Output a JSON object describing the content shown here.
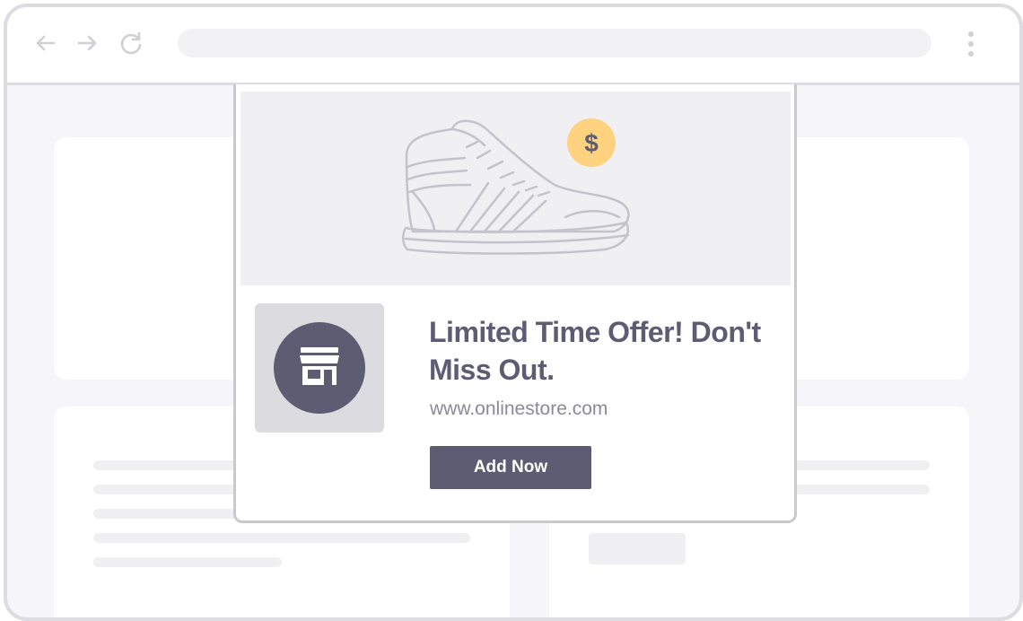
{
  "browser": {
    "back_icon": "arrow-left-icon",
    "forward_icon": "arrow-right-icon",
    "reload_icon": "reload-icon",
    "menu_icon": "vertical-dots-icon"
  },
  "ad": {
    "headline": "Limited Time Offer! Don't Miss Out.",
    "url": "www.onlinestore.com",
    "cta_label": "Add Now",
    "price_badge": "$",
    "hero_icon": "sneaker-icon",
    "store_icon": "storefront-icon"
  },
  "colors": {
    "accent": "#5d5c72",
    "badge": "#ffd27f",
    "background": "#f6f6f8",
    "border": "#dcdce1"
  }
}
